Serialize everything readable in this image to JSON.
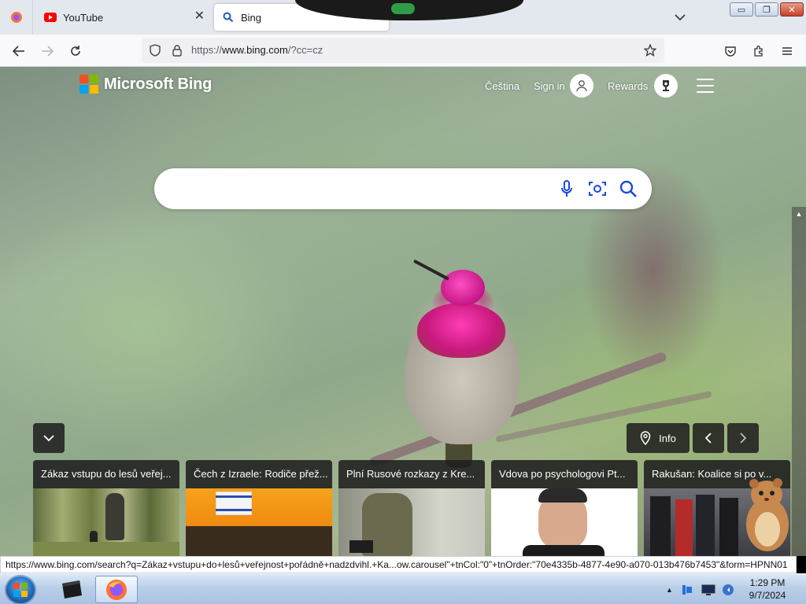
{
  "browser": {
    "tabs": [
      {
        "label": "YouTube"
      },
      {
        "label": "Bing"
      }
    ],
    "url": {
      "prefix": "https://",
      "host": "www.bing.com",
      "path": "/?cc=cz"
    },
    "window_controls": {
      "minimize": "▭",
      "maximize": "❐",
      "close": "✕"
    }
  },
  "bing": {
    "logo_text": "Microsoft Bing",
    "language_link": "Čeština",
    "sign_in": "Sign in",
    "rewards": "Rewards",
    "search": {
      "placeholder": "",
      "value": ""
    },
    "info_label": "Info",
    "news": [
      {
        "title": "Zákaz vstupu do lesů veřej..."
      },
      {
        "title": "Čech z Izraele: Rodiče přež..."
      },
      {
        "title": "Plní Rusové rozkazy z Kre..."
      },
      {
        "title": "Vdova po psychologovi Pt..."
      },
      {
        "title": "Rakušan: Koalice si po v..."
      }
    ]
  },
  "status_url": "https://www.bing.com/search?q=Zákaz+vstupu+do+lesů+veřejnost+pořádně+nadzdvihl.+Ka...ow.carousel\"+tnCol:\"0\"+tnOrder:\"70e4335b-4877-4e90-a070-013b476b7453\"&form=HPNN01",
  "taskbar": {
    "time": "1:29 PM",
    "date": "9/7/2024"
  },
  "colors": {
    "ms_red": "#f25022",
    "ms_green": "#7fba00",
    "ms_blue": "#00a4ef",
    "ms_yellow": "#ffb900",
    "bing_icon_blue": "#174ae4"
  }
}
